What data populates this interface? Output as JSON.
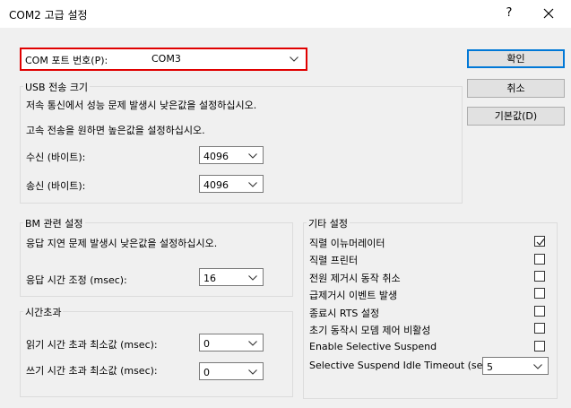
{
  "window": {
    "title": "COM2 고급 설정",
    "help": "?"
  },
  "port": {
    "label": "COM 포트 번호(P):",
    "value": "COM3"
  },
  "buttons": {
    "ok": "확인",
    "cancel": "취소",
    "defaults": "기본값(D)"
  },
  "usb": {
    "title": "USB 전송 크기",
    "desc1": "저속 통신에서 성능 문제 발생시 낮은값을 설정하십시오.",
    "desc2": "고속 전송을 원하면 높은값을 설정하십시오.",
    "receive_label": "수신 (바이트):",
    "receive_value": "4096",
    "transmit_label": "송신 (바이트):",
    "transmit_value": "4096"
  },
  "bm": {
    "title": "BM 관련 설정",
    "desc": "응답 지연 문제 발생시 낮은값을 설정하십시오.",
    "latency_label": "응답 시간 조정 (msec):",
    "latency_value": "16"
  },
  "timeouts": {
    "title": "시간초과",
    "read_label": "읽기 시간 초과 최소값 (msec):",
    "read_value": "0",
    "write_label": "쓰기 시간 초과 최소값 (msec):",
    "write_value": "0"
  },
  "misc": {
    "title": "기타 설정",
    "items": [
      {
        "label": "직렬 이뉴머레이터",
        "checked": true
      },
      {
        "label": "직렬 프린터",
        "checked": false
      },
      {
        "label": "전원 제거시 동작 취소",
        "checked": false
      },
      {
        "label": "급제거시 이벤트 발생",
        "checked": false
      },
      {
        "label": "종료시 RTS 설정",
        "checked": false
      },
      {
        "label": "초기 동작시 모뎀 제어 비활성",
        "checked": false
      },
      {
        "label": "Enable Selective Suspend",
        "checked": false
      }
    ],
    "idle_label": "Selective Suspend Idle Timeout (secs):",
    "idle_value": "5"
  },
  "colors": {
    "accent_border": "#0078d7",
    "highlight_box": "#e00000"
  },
  "icons": {
    "close": "close-icon",
    "dropdown": "chevron-down-icon",
    "check": "checkmark-icon"
  }
}
